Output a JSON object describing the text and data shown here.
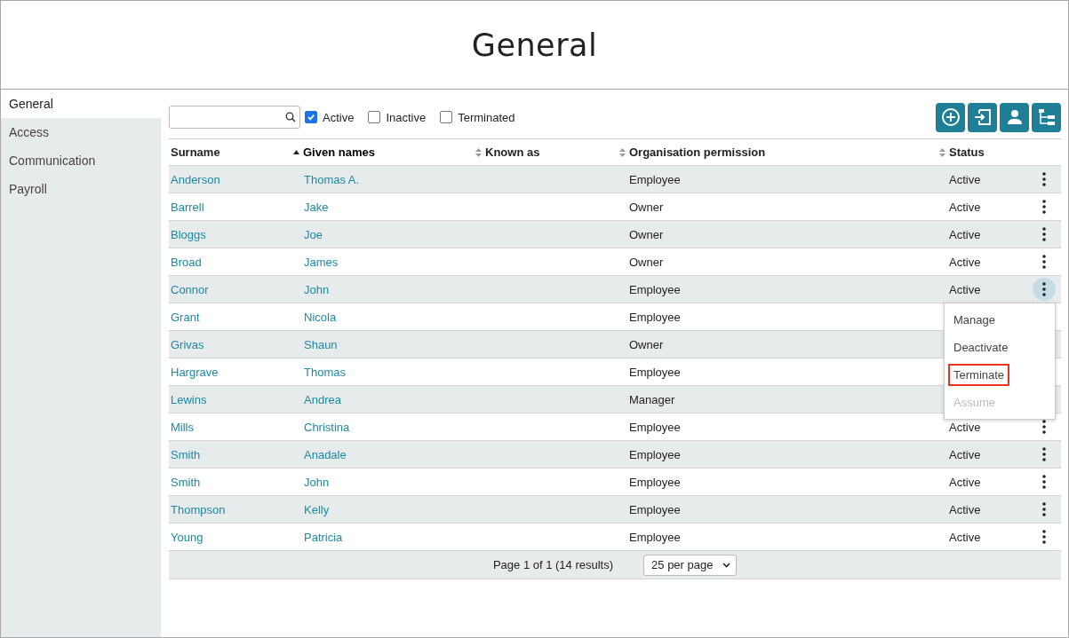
{
  "page_title": "General",
  "sidebar": {
    "items": [
      {
        "label": "General",
        "selected": true
      },
      {
        "label": "Access",
        "selected": false
      },
      {
        "label": "Communication",
        "selected": false
      },
      {
        "label": "Payroll",
        "selected": false
      }
    ]
  },
  "filters": [
    {
      "label": "Active",
      "checked": true
    },
    {
      "label": "Inactive",
      "checked": false
    },
    {
      "label": "Terminated",
      "checked": false
    }
  ],
  "toolbar": [
    {
      "kind": "add"
    },
    {
      "kind": "import"
    },
    {
      "kind": "person"
    },
    {
      "kind": "tree"
    }
  ],
  "table": {
    "columns": [
      {
        "label": "Surname",
        "sortable": false
      },
      {
        "label": "Given names",
        "sortable": true,
        "sorted": true
      },
      {
        "label": "Known as",
        "sortable": true,
        "sorted": false
      },
      {
        "label": "Organisation permission",
        "sortable": true,
        "sorted": false
      },
      {
        "label": "Status",
        "sortable": true,
        "sorted": false
      }
    ],
    "rows": [
      {
        "surname": "Anderson",
        "given": "Thomas A.",
        "permission": "Employee",
        "status": "Active",
        "menu_open": false
      },
      {
        "surname": "Barrell",
        "given": "Jake",
        "permission": "Owner",
        "status": "Active",
        "menu_open": false
      },
      {
        "surname": "Bloggs",
        "given": "Joe",
        "permission": "Owner",
        "status": "Active",
        "menu_open": false
      },
      {
        "surname": "Broad",
        "given": "James",
        "permission": "Owner",
        "status": "Active",
        "menu_open": false
      },
      {
        "surname": "Connor",
        "given": "John",
        "permission": "Employee",
        "status": "Active",
        "menu_open": true
      },
      {
        "surname": "Grant",
        "given": "Nicola",
        "permission": "Employee"
      },
      {
        "surname": "Grivas",
        "given": "Shaun",
        "permission": "Owner"
      },
      {
        "surname": "Hargrave",
        "given": "Thomas",
        "permission": "Employee"
      },
      {
        "surname": "Lewins",
        "given": "Andrea",
        "permission": "Manager"
      },
      {
        "surname": "Mills",
        "given": "Christina",
        "permission": "Employee",
        "status": "Active",
        "menu_open": false
      },
      {
        "surname": "Smith",
        "given": "Anadale",
        "permission": "Employee",
        "status": "Active",
        "menu_open": false
      },
      {
        "surname": "Smith",
        "given": "John",
        "permission": "Employee",
        "status": "Active",
        "menu_open": false
      },
      {
        "surname": "Thompson",
        "given": "Kelly",
        "permission": "Employee",
        "status": "Active",
        "menu_open": false
      },
      {
        "surname": "Young",
        "given": "Patricia",
        "permission": "Employee",
        "status": "Active",
        "menu_open": false
      }
    ]
  },
  "row_menu": {
    "items": [
      {
        "label": "Manage",
        "disabled": false,
        "outlined": false
      },
      {
        "label": "Deactivate",
        "disabled": false,
        "outlined": false
      },
      {
        "label": "Terminate",
        "disabled": false,
        "outlined": true
      },
      {
        "label": "Assume",
        "disabled": true,
        "outlined": false
      }
    ]
  },
  "pagination": {
    "summary": "Page 1 of 1 (14 results)",
    "page_size": "25 per page"
  }
}
